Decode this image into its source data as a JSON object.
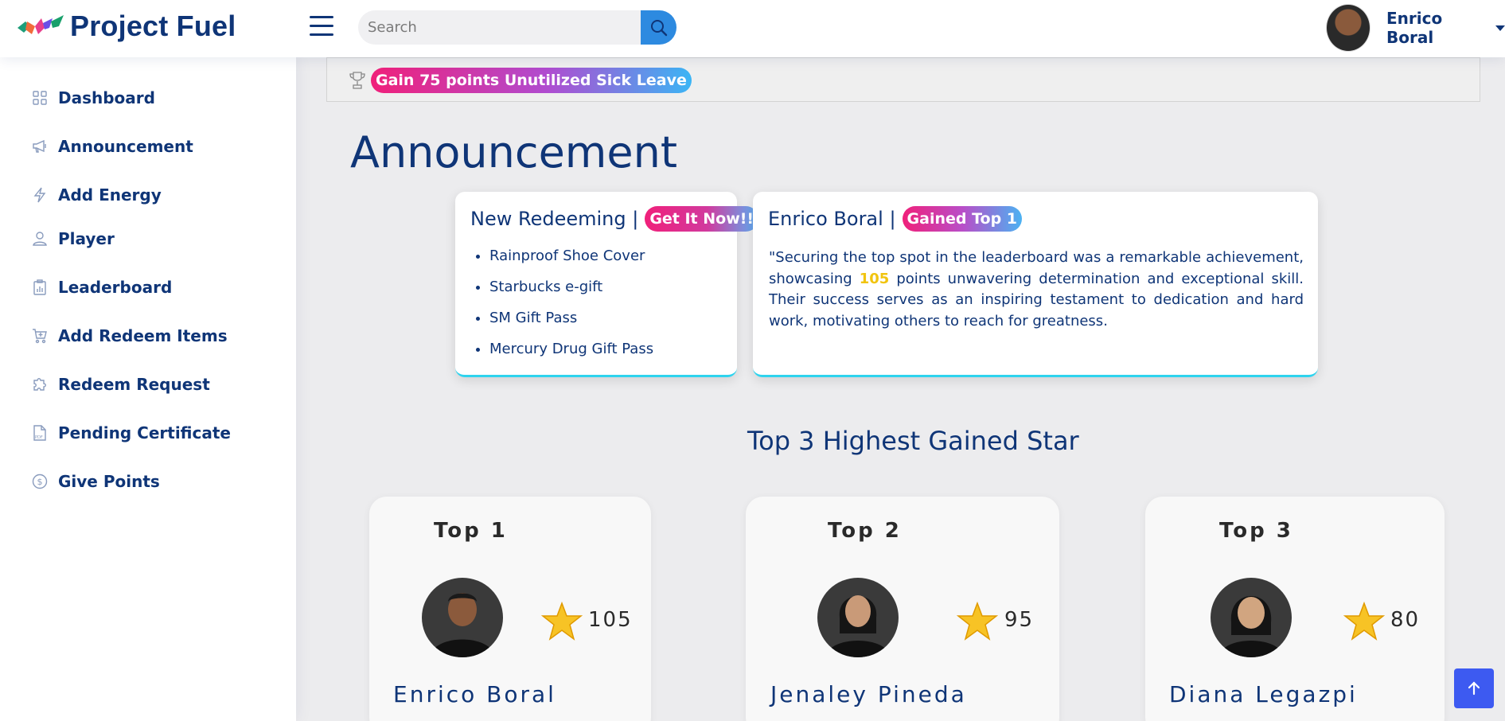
{
  "app": {
    "name": "Project Fuel"
  },
  "header": {
    "search_placeholder": "Search",
    "user_name": "Enrico Boral"
  },
  "sidebar": {
    "items": [
      {
        "label": "Dashboard",
        "icon": "grid-icon"
      },
      {
        "label": "Announcement",
        "icon": "megaphone-icon"
      },
      {
        "label": "Add Energy",
        "icon": "lightning-icon"
      },
      {
        "label": "Player",
        "icon": "person-icon"
      },
      {
        "label": "Leaderboard",
        "icon": "clipboard-chart-icon"
      },
      {
        "label": "Add Redeem Items",
        "icon": "cart-icon"
      },
      {
        "label": "Redeem Request",
        "icon": "puzzle-icon"
      },
      {
        "label": "Pending Certificate",
        "icon": "pdf-file-icon"
      },
      {
        "label": "Give Points",
        "icon": "coin-icon"
      }
    ]
  },
  "banner": {
    "text": "Gain 75 points Unutilized Sick Leave"
  },
  "page_title": "Announcement",
  "redeem_card": {
    "title": "New Redeeming |",
    "badge": "Get It Now!!",
    "items": [
      "Rainproof Shoe Cover",
      "Starbucks e-gift",
      "SM Gift Pass",
      "Mercury Drug Gift Pass"
    ]
  },
  "top_card": {
    "title": "Enrico Boral |",
    "badge": "Gained Top 1",
    "quote_before": "\"Securing the top spot in the leaderboard was a remarkable achievement, showcasing ",
    "quote_points": "105",
    "quote_after": " points unwavering determination and exceptional skill. Their success serves as an inspiring testament to dedication and hard work, motivating others to reach for greatness."
  },
  "section_title": "Top 3 Highest Gained Star",
  "top3": [
    {
      "rank": "Top 1",
      "name": "Enrico Boral",
      "points": "105"
    },
    {
      "rank": "Top 2",
      "name": "Jenaley Pineda",
      "points": "95"
    },
    {
      "rank": "Top 3",
      "name": "Diana Legazpi",
      "points": "80"
    }
  ],
  "colors": {
    "primary": "#0f3577",
    "accent_blue": "#2d8ae0",
    "pill_pink": "#f0207a",
    "card_border": "#2ed3ee",
    "highlight": "#f1c40f",
    "scroll_button": "#3d5af1"
  }
}
